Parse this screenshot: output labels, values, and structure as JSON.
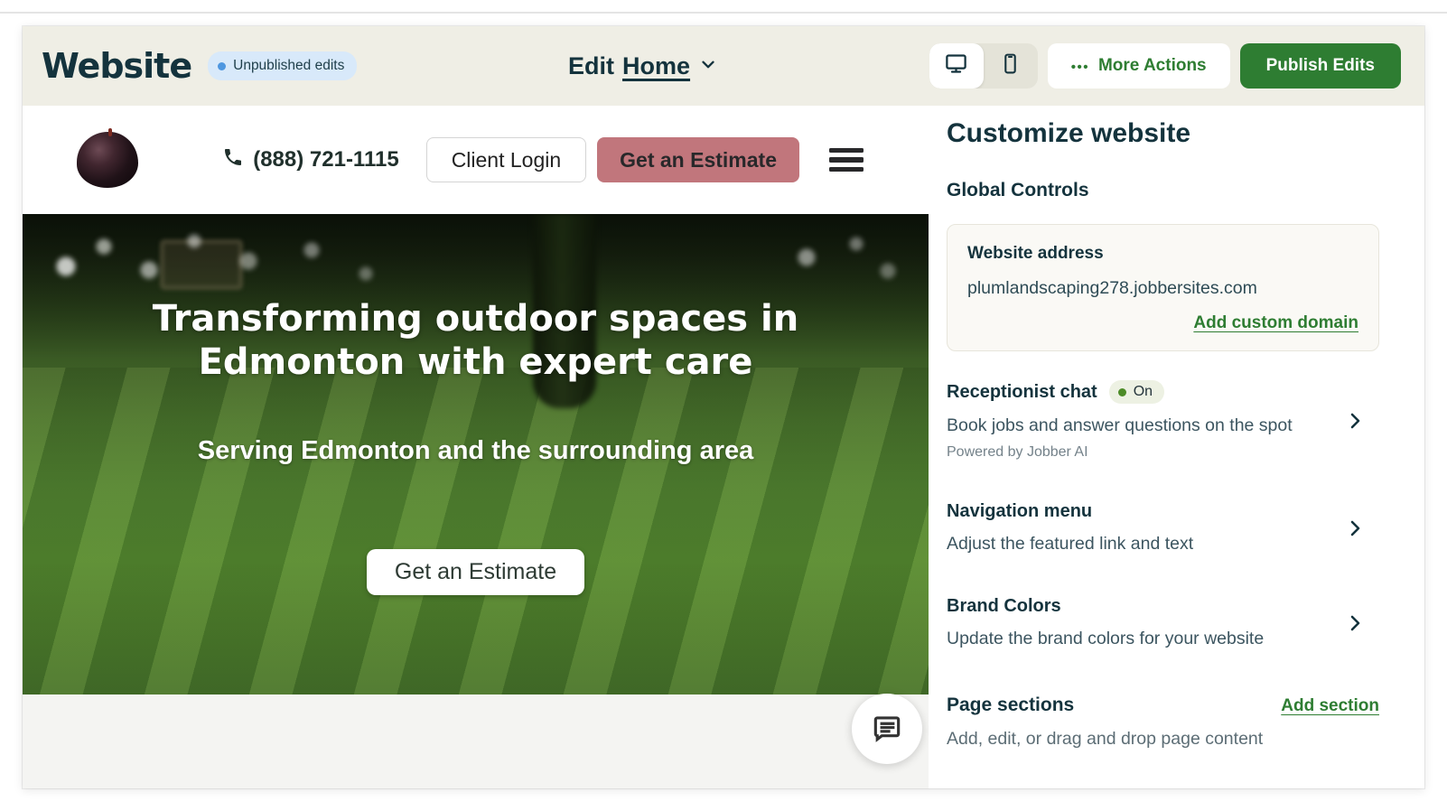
{
  "topbar": {
    "app_title": "Website",
    "status_badge": "Unpublished edits",
    "edit_label": "Edit",
    "current_page": "Home",
    "more_actions_icon": "•••",
    "more_actions": "More Actions",
    "publish": "Publish Edits"
  },
  "site_preview": {
    "header": {
      "phone": "(888) 721-1115",
      "client_login": "Client Login",
      "get_estimate": "Get an Estimate"
    },
    "hero": {
      "headline": "Transforming outdoor spaces in Edmonton with expert care",
      "subheadline": "Serving Edmonton and the surrounding area",
      "cta": "Get an Estimate"
    }
  },
  "sidebar": {
    "title": "Customize website",
    "global_controls": "Global Controls",
    "website_address": {
      "label": "Website address",
      "url": "plumlandscaping278.jobbersites.com",
      "action": "Add custom domain"
    },
    "receptionist_chat": {
      "label": "Receptionist chat",
      "status": "On",
      "description": "Book jobs and answer questions on the spot",
      "footnote": "Powered by Jobber AI"
    },
    "navigation_menu": {
      "label": "Navigation menu",
      "description": "Adjust the featured link and text"
    },
    "brand_colors": {
      "label": "Brand Colors",
      "description": "Update the brand colors for your website"
    },
    "page_sections": {
      "label": "Page sections",
      "action": "Add section",
      "description": "Add, edit, or drag and drop page content"
    }
  },
  "colors": {
    "accent_green": "#2e7d32",
    "navy_text": "#14333d",
    "topbar_bg": "#efeee5",
    "unpublished_badge_bg": "#d8e9fa",
    "unpublished_dot_blue": "#4e97e0",
    "on_badge_bg": "#edf1e3",
    "on_dot_green": "#4c8b27",
    "estimate_button_pink": "#c1767c"
  }
}
